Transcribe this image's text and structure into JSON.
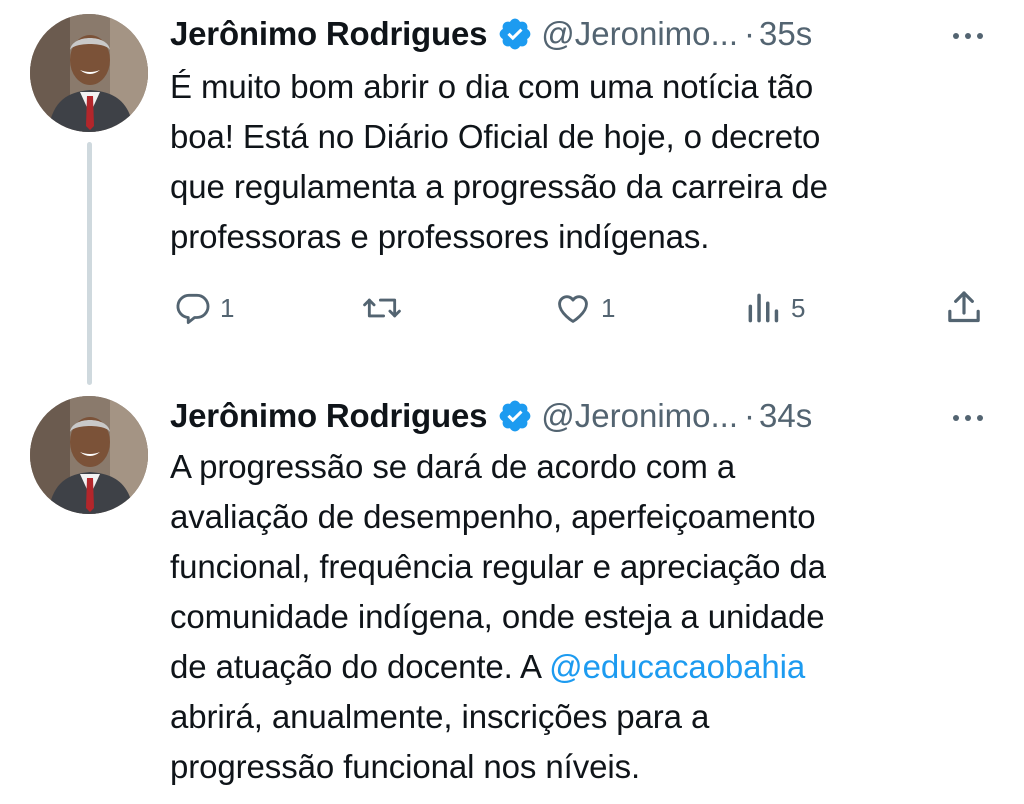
{
  "tweets": [
    {
      "author_name": "Jerônimo Rodrigues",
      "handle": "@Jeronimo...",
      "separator": "·",
      "time": "35s",
      "text_lines": [
        "É muito bom abrir o dia com uma notícia tão",
        "boa! Está no Diário Oficial de hoje, o decreto",
        "que regulamenta a progressão da carreira de",
        "professoras e professores indígenas."
      ],
      "reply_count": "1",
      "like_count": "1",
      "view_count": "5"
    },
    {
      "author_name": "Jerônimo Rodrigues",
      "handle": "@Jeronimo...",
      "separator": "·",
      "time": "34s",
      "text_lines": [
        "A progressão se dará de acordo com a",
        "avaliação de desempenho, aperfeiçoamento",
        "funcional, frequência regular e apreciação da",
        "comunidade indígena, onde esteja a unidade",
        "de atuação do docente. A ",
        "abrirá, anualmente, inscrições para a",
        "progressão funcional nos níveis."
      ],
      "mention": "@educacaobahia"
    }
  ],
  "icons": {
    "verified": "verified-badge-icon",
    "more": "more-options-icon",
    "reply": "reply-icon",
    "retweet": "retweet-icon",
    "like": "heart-icon",
    "views": "views-icon",
    "share": "share-icon"
  },
  "colors": {
    "verified_blue": "#1d9bf0",
    "mention_blue": "#1d9bf0",
    "muted_gray": "#536471",
    "thread_line": "#cfd9de"
  }
}
